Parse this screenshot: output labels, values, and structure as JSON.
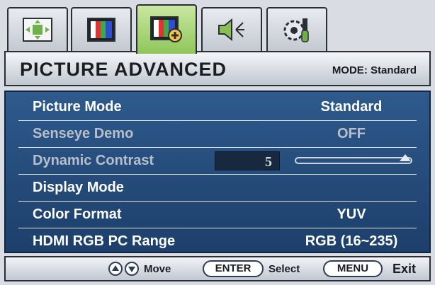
{
  "tabs": [
    {
      "icon": "display-position-icon",
      "active": false
    },
    {
      "icon": "picture-color-bars-icon",
      "active": false
    },
    {
      "icon": "picture-advanced-icon",
      "active": true
    },
    {
      "icon": "speaker-audio-icon",
      "active": false
    },
    {
      "icon": "system-settings-icon",
      "active": false
    }
  ],
  "header": {
    "title": "PICTURE ADVANCED",
    "mode_line": "MODE: Standard"
  },
  "menu": {
    "picture_mode": {
      "label": "Picture Mode",
      "value": "Standard"
    },
    "senseye_demo": {
      "label": "Senseye Demo",
      "value": "OFF"
    },
    "dynamic_contrast": {
      "label": "Dynamic Contrast",
      "value": "5",
      "level": 1.0
    },
    "display_mode": {
      "label": "Display Mode"
    },
    "color_format": {
      "label": "Color Format",
      "value": "YUV"
    },
    "hdmi_range": {
      "label": "HDMI RGB PC Range",
      "value": "RGB (16~235)"
    }
  },
  "footer": {
    "move_label": "Move",
    "enter_key": "ENTER",
    "select_label": "Select",
    "menu_key": "MENU",
    "exit_label": "Exit"
  },
  "colors": {
    "active_tab": "#8fc65a",
    "list_bg": "#2e5a8c",
    "dim_text": "#b7bfca"
  }
}
